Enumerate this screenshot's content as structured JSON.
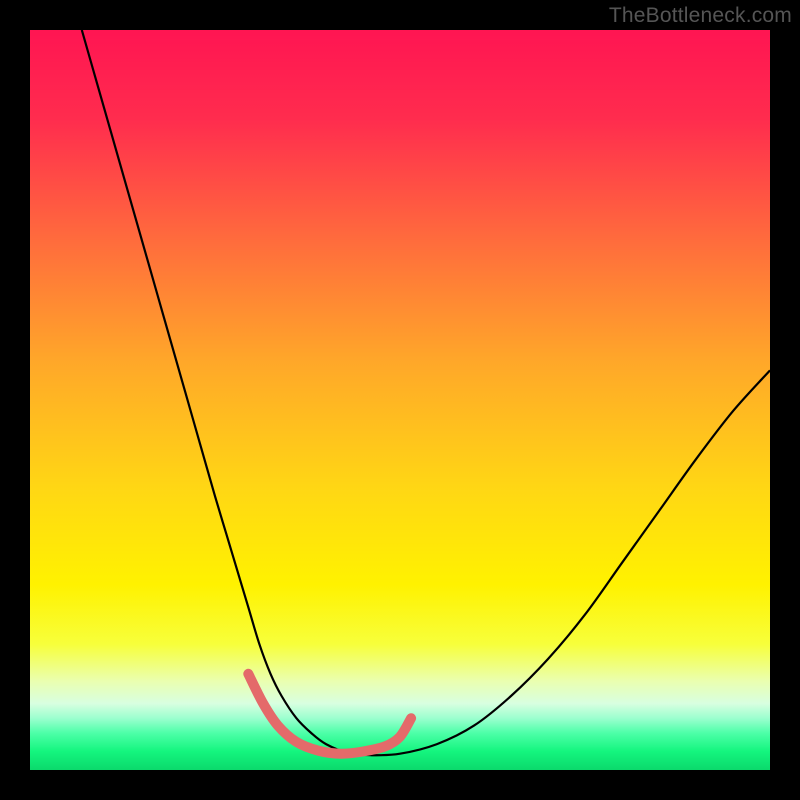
{
  "watermark": "TheBottleneck.com",
  "chart_data": {
    "type": "line",
    "title": "",
    "xlabel": "",
    "ylabel": "",
    "xlim": [
      0,
      100
    ],
    "ylim": [
      0,
      100
    ],
    "grid": false,
    "legend": false,
    "background_gradient_stops": [
      {
        "pct": 0,
        "color": "#ff1552"
      },
      {
        "pct": 12,
        "color": "#ff2c4e"
      },
      {
        "pct": 28,
        "color": "#ff6a3d"
      },
      {
        "pct": 45,
        "color": "#ffa829"
      },
      {
        "pct": 62,
        "color": "#ffd714"
      },
      {
        "pct": 75,
        "color": "#fff200"
      },
      {
        "pct": 83,
        "color": "#f7ff3b"
      },
      {
        "pct": 88,
        "color": "#eaffb0"
      },
      {
        "pct": 91,
        "color": "#d8ffe0"
      },
      {
        "pct": 93,
        "color": "#9cffcf"
      },
      {
        "pct": 95,
        "color": "#4dffa8"
      },
      {
        "pct": 97.5,
        "color": "#14f57e"
      },
      {
        "pct": 100,
        "color": "#0bd96c"
      }
    ],
    "series": [
      {
        "name": "bottleneck-curve",
        "stroke": "#000000",
        "stroke_width": 2.2,
        "x": [
          7,
          9,
          11,
          13,
          15,
          17,
          19,
          21,
          23,
          25,
          26.5,
          28,
          29.5,
          31,
          32.5,
          34,
          36,
          38,
          40,
          43,
          46,
          50,
          55,
          60,
          65,
          70,
          75,
          80,
          85,
          90,
          95,
          100
        ],
        "y": [
          100,
          93,
          86,
          79,
          72,
          65,
          58,
          51,
          44,
          37,
          32,
          27,
          22,
          17,
          13,
          10,
          7,
          5,
          3.5,
          2.3,
          2.0,
          2.2,
          3.5,
          6,
          10,
          15,
          21,
          28,
          35,
          42,
          48.5,
          54
        ]
      },
      {
        "name": "highlight-dip",
        "stroke": "#e46a6a",
        "stroke_width": 10,
        "linecap": "round",
        "x": [
          29.5,
          31.5,
          33.5,
          36,
          39,
          42,
          45,
          48,
          50,
          51.5
        ],
        "y": [
          13,
          9,
          6,
          3.8,
          2.6,
          2.2,
          2.5,
          3.2,
          4.5,
          7
        ]
      }
    ]
  }
}
